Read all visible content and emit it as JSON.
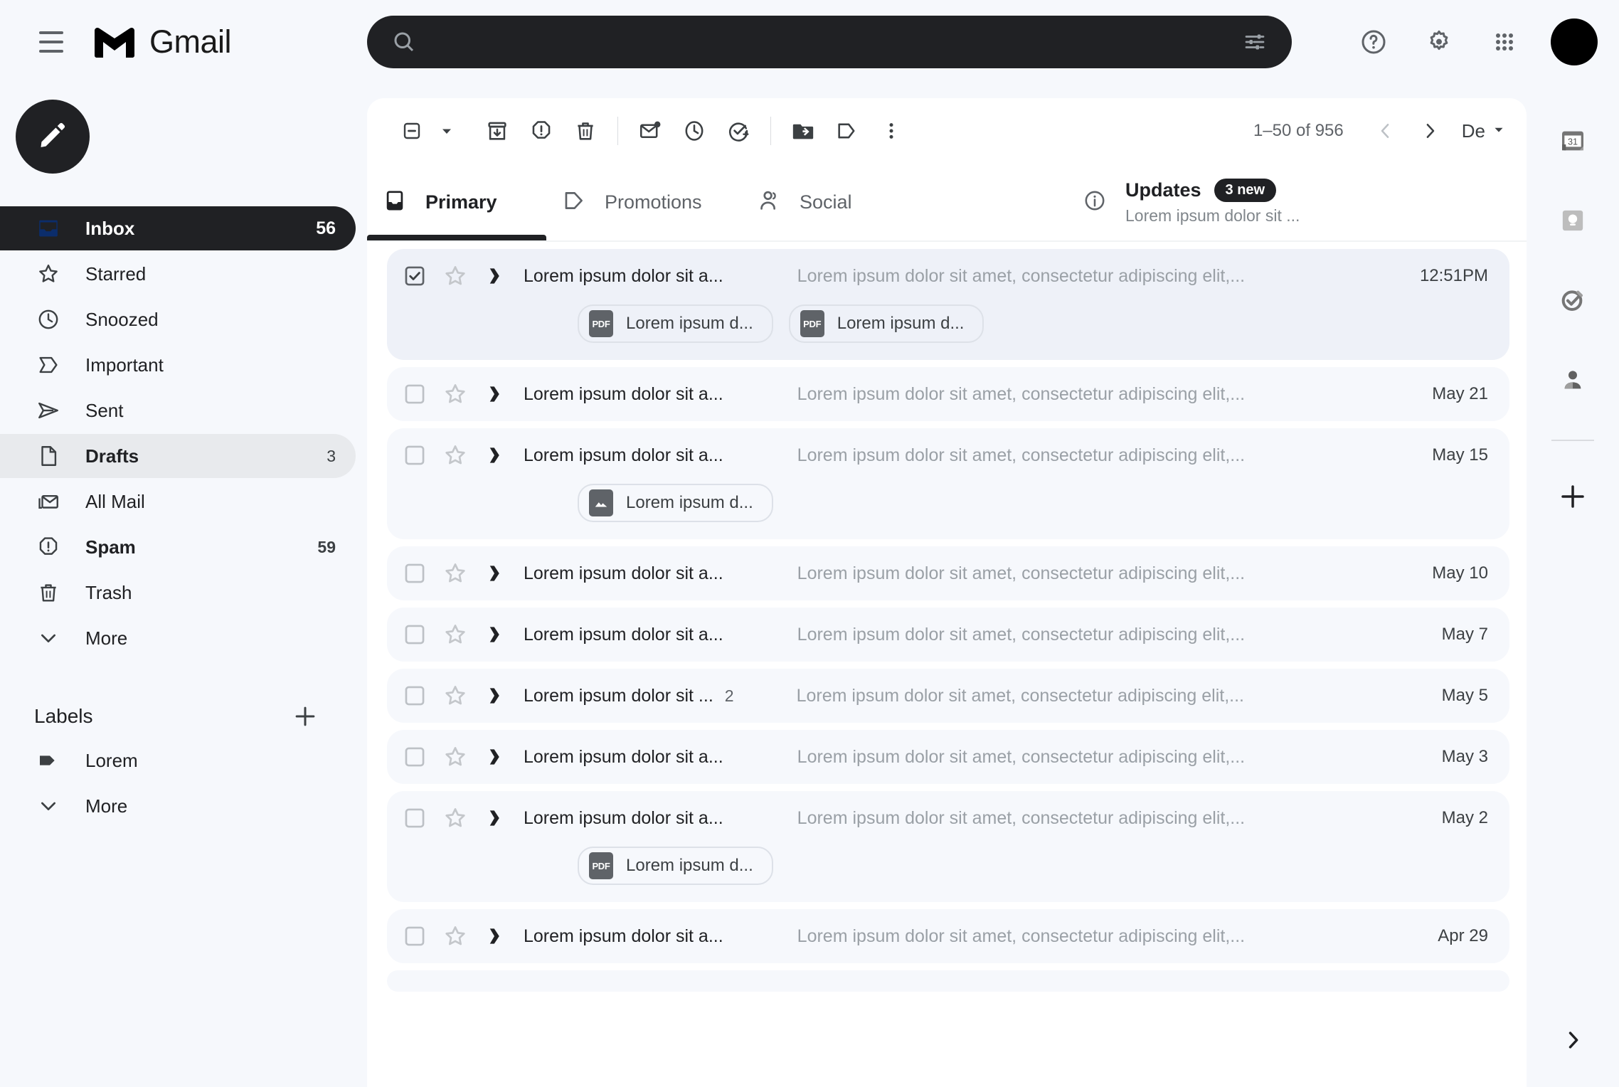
{
  "app": {
    "name": "Gmail"
  },
  "header": {
    "menu_icon": "hamburger-menu-icon",
    "logo_icon": "gmail-logo-icon",
    "search": {
      "value": "",
      "placeholder": "",
      "search_icon": "search-icon",
      "filter_icon": "tune-filter-icon"
    },
    "actions": [
      {
        "name": "help",
        "icon": "help-circle-icon"
      },
      {
        "name": "settings",
        "icon": "gear-icon"
      },
      {
        "name": "apps",
        "icon": "apps-grid-icon"
      }
    ],
    "avatar": {
      "name": "account-avatar",
      "color": "#000000"
    }
  },
  "sidebar": {
    "compose": {
      "label": "",
      "icon": "pencil-compose-icon"
    },
    "items": [
      {
        "label": "Inbox",
        "count": "56",
        "icon": "inbox-icon",
        "state": "active"
      },
      {
        "label": "Starred",
        "count": "",
        "icon": "star-icon",
        "state": "normal"
      },
      {
        "label": "Snoozed",
        "count": "",
        "icon": "clock-icon",
        "state": "normal"
      },
      {
        "label": "Important",
        "count": "",
        "icon": "important-icon",
        "state": "normal"
      },
      {
        "label": "Sent",
        "count": "",
        "icon": "send-icon",
        "state": "normal"
      },
      {
        "label": "Drafts",
        "count": "3",
        "icon": "draft-icon",
        "state": "hovered"
      },
      {
        "label": "All Mail",
        "count": "",
        "icon": "all-mail-icon",
        "state": "normal"
      },
      {
        "label": "Spam",
        "count": "59",
        "icon": "spam-icon",
        "state": "bold"
      },
      {
        "label": "Trash",
        "count": "",
        "icon": "trash-icon",
        "state": "normal"
      },
      {
        "label": "More",
        "count": "",
        "icon": "chevron-down-icon",
        "state": "normal"
      }
    ],
    "labels_header": {
      "title": "Labels",
      "add_icon": "plus-icon"
    },
    "labels": [
      {
        "label": "Lorem",
        "count": "",
        "icon": "label-tag-icon",
        "state": "normal"
      },
      {
        "label": "More",
        "count": "",
        "icon": "chevron-down-icon",
        "state": "normal"
      }
    ]
  },
  "toolbar": {
    "buttons": [
      {
        "name": "select-all-checkbox",
        "icon": "indeterminate-checkbox-icon"
      },
      {
        "name": "select-dropdown",
        "icon": "caret-down-icon"
      },
      {
        "name": "archive",
        "icon": "archive-icon"
      },
      {
        "name": "report-spam",
        "icon": "report-spam-icon"
      },
      {
        "name": "delete",
        "icon": "trash-icon"
      },
      {
        "name": "mark-unread",
        "icon": "mark-unread-icon"
      },
      {
        "name": "snooze",
        "icon": "clock-icon"
      },
      {
        "name": "add-to-tasks",
        "icon": "add-task-icon"
      },
      {
        "name": "move-to",
        "icon": "move-to-folder-icon"
      },
      {
        "name": "labels",
        "icon": "label-tag-icon"
      },
      {
        "name": "more-options",
        "icon": "more-vertical-icon"
      }
    ],
    "pagination": {
      "range": "1–50 of 956",
      "prev_icon": "chevron-left-icon",
      "next_icon": "chevron-right-icon"
    },
    "density": {
      "label": "De",
      "caret_icon": "caret-down-icon"
    }
  },
  "tabs": [
    {
      "label": "Primary",
      "icon": "inbox-tab-icon",
      "active": true,
      "badge": "",
      "subtitle": ""
    },
    {
      "label": "Promotions",
      "icon": "label-tag-icon",
      "active": false,
      "badge": "",
      "subtitle": ""
    },
    {
      "label": "Social",
      "icon": "people-icon",
      "active": false,
      "badge": "",
      "subtitle": ""
    },
    {
      "label": "Updates",
      "icon": "info-circle-icon",
      "active": false,
      "badge": "3 new",
      "subtitle": "Lorem ipsum dolor sit ..."
    }
  ],
  "emails": [
    {
      "sender": "Lorem ipsum dolor sit a...",
      "thread_count": "",
      "subject": "Lorem ipsum dolor sit amet, consectetur adipiscing elit,...",
      "date": "12:51PM",
      "selected": true,
      "attachments": [
        {
          "name": "Lorem ipsum d...",
          "type": "PDF"
        },
        {
          "name": "Lorem ipsum d...",
          "type": "PDF"
        }
      ]
    },
    {
      "sender": "Lorem ipsum dolor sit a...",
      "thread_count": "",
      "subject": "Lorem ipsum dolor sit amet, consectetur adipiscing elit,...",
      "date": "May 21",
      "selected": false,
      "attachments": []
    },
    {
      "sender": "Lorem ipsum dolor sit a...",
      "thread_count": "",
      "subject": "Lorem ipsum dolor sit amet, consectetur adipiscing elit,...",
      "date": "May 15",
      "selected": false,
      "attachments": [
        {
          "name": "Lorem ipsum d...",
          "type": "IMG"
        }
      ]
    },
    {
      "sender": "Lorem ipsum dolor sit a...",
      "thread_count": "",
      "subject": "Lorem ipsum dolor sit amet, consectetur adipiscing elit,...",
      "date": "May 10",
      "selected": false,
      "attachments": []
    },
    {
      "sender": "Lorem ipsum dolor sit a...",
      "thread_count": "",
      "subject": "Lorem ipsum dolor sit amet, consectetur adipiscing elit,...",
      "date": "May 7",
      "selected": false,
      "attachments": []
    },
    {
      "sender": "Lorem ipsum dolor sit ...",
      "thread_count": "2",
      "subject": "Lorem ipsum dolor sit amet, consectetur adipiscing elit,...",
      "date": "May 5",
      "selected": false,
      "attachments": []
    },
    {
      "sender": "Lorem ipsum dolor sit a...",
      "thread_count": "",
      "subject": "Lorem ipsum dolor sit amet, consectetur adipiscing elit,...",
      "date": "May 3",
      "selected": false,
      "attachments": []
    },
    {
      "sender": "Lorem ipsum dolor sit a...",
      "thread_count": "",
      "subject": "Lorem ipsum dolor sit amet, consectetur adipiscing elit,...",
      "date": "May 2",
      "selected": false,
      "attachments": [
        {
          "name": "Lorem ipsum d...",
          "type": "PDF"
        }
      ]
    },
    {
      "sender": "Lorem ipsum dolor sit a...",
      "thread_count": "",
      "subject": "Lorem ipsum dolor sit amet, consectetur adipiscing elit,...",
      "date": "Apr 29",
      "selected": false,
      "attachments": []
    },
    {
      "sender": "",
      "thread_count": "",
      "subject": "",
      "date": "",
      "selected": false,
      "attachments": []
    }
  ],
  "right_rail": {
    "items": [
      {
        "name": "calendar",
        "icon": "calendar-31-icon"
      },
      {
        "name": "keep",
        "icon": "keep-lightbulb-icon"
      },
      {
        "name": "tasks",
        "icon": "tasks-check-icon"
      },
      {
        "name": "contacts",
        "icon": "contacts-person-icon"
      }
    ],
    "add": {
      "name": "add-app",
      "icon": "plus-icon"
    },
    "expand": {
      "name": "expand-panel",
      "icon": "chevron-right-icon"
    }
  }
}
